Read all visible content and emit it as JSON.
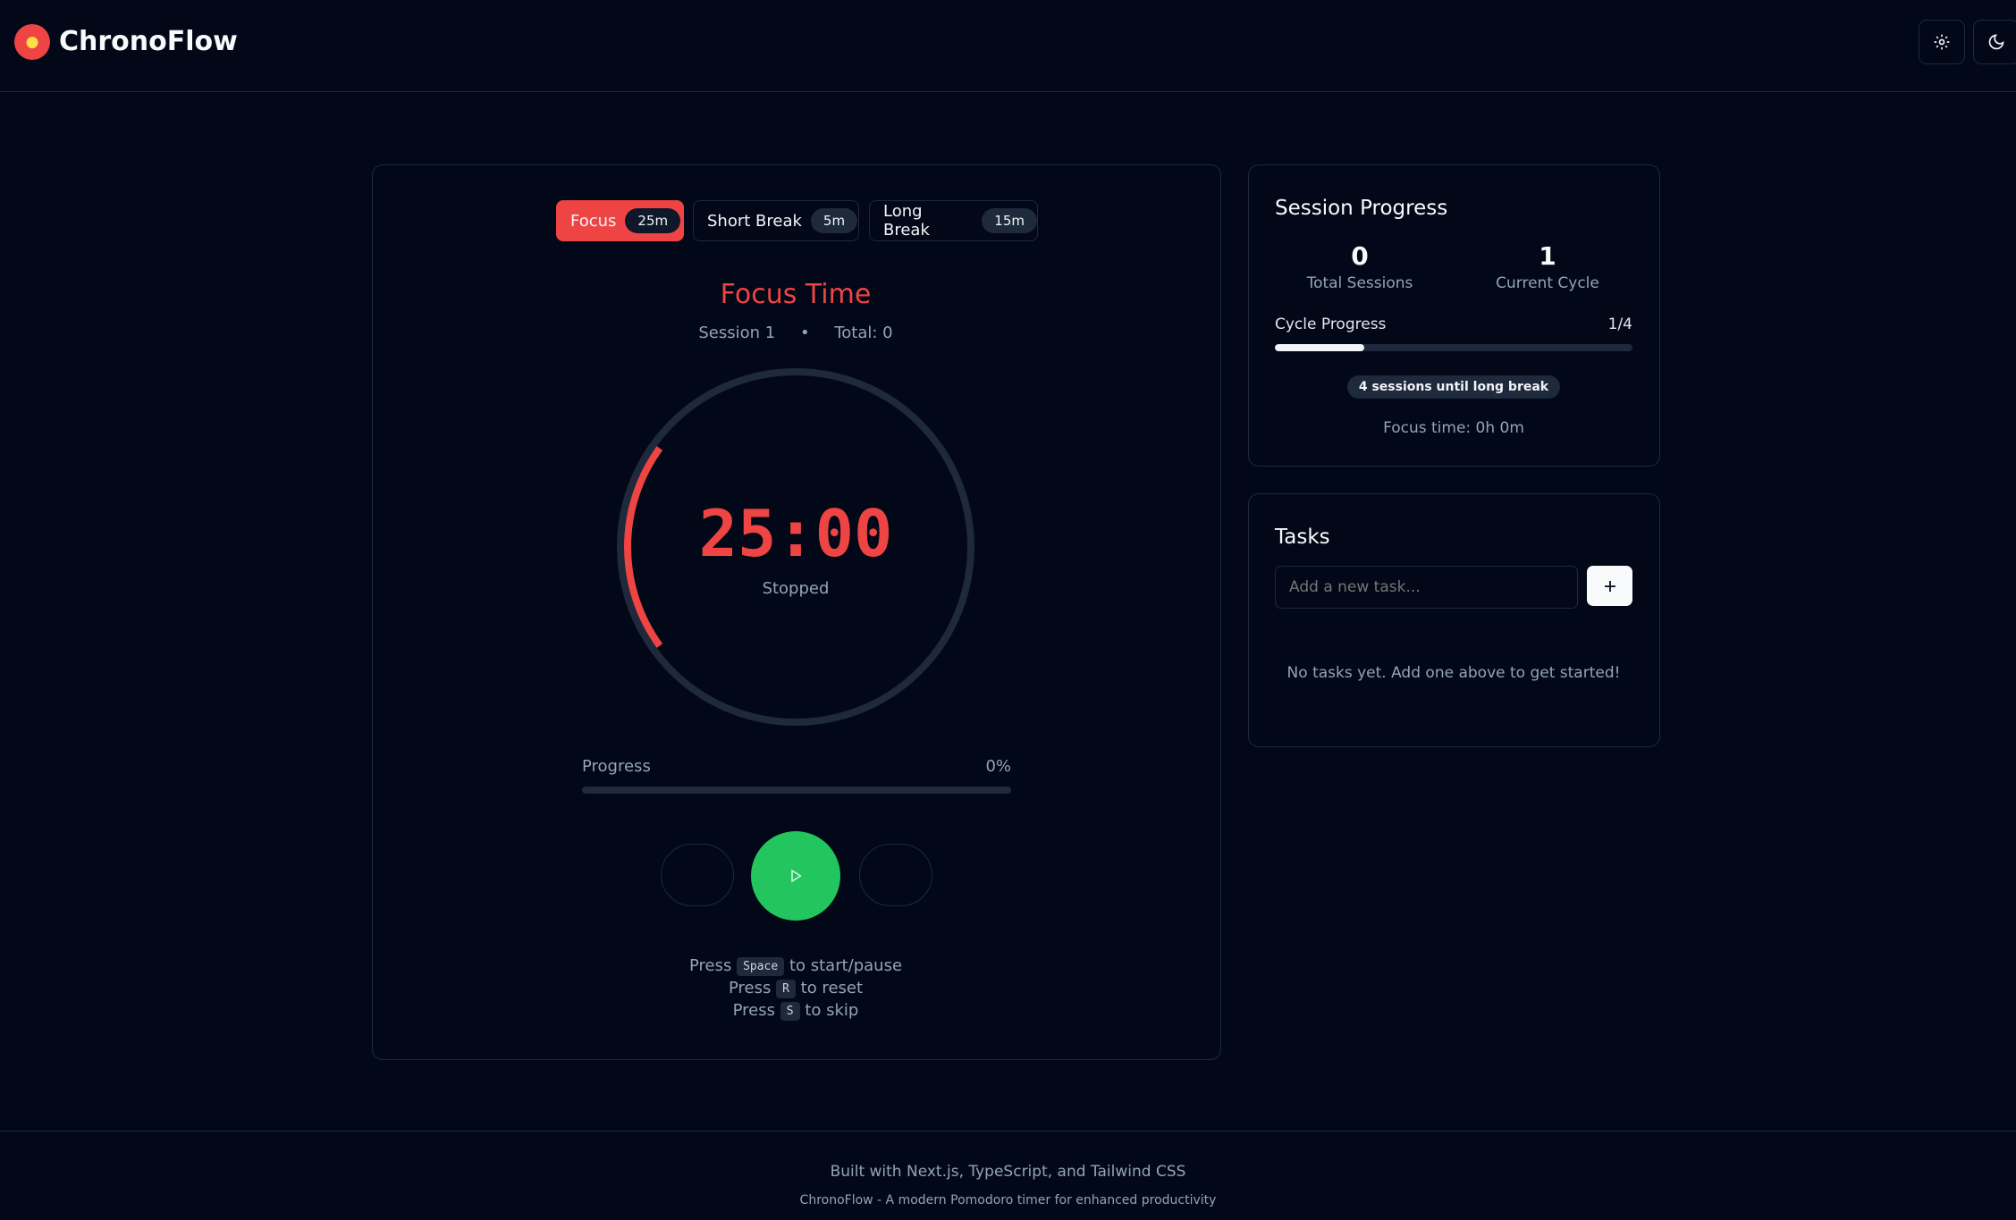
{
  "app": {
    "name": "ChronoFlow",
    "logo_icon": "tomato-icon",
    "accent": "#ef4444",
    "success": "#22c55e"
  },
  "header": {
    "settings_icon": "gear-icon",
    "theme_icon": "moon-icon"
  },
  "modes": [
    {
      "label": "Focus",
      "duration": "25m",
      "active": true
    },
    {
      "label": "Short Break",
      "duration": "5m",
      "active": false
    },
    {
      "label": "Long Break",
      "duration": "15m",
      "active": false
    }
  ],
  "timer": {
    "mode_title": "Focus Time",
    "session_label": "Session 1",
    "separator": "•",
    "total_label": "Total: 0",
    "time": "25:00",
    "status": "Stopped",
    "ring_fraction": 0.2,
    "progress_label": "Progress",
    "progress_value": "0%",
    "progress_fraction": 0
  },
  "controls": {
    "play_icon": "play-icon"
  },
  "shortcuts": [
    {
      "pre": "Press",
      "key": "Space",
      "post": "to start/pause"
    },
    {
      "pre": "Press",
      "key": "R",
      "post": "to reset"
    },
    {
      "pre": "Press",
      "key": "S",
      "post": "to skip"
    }
  ],
  "session_progress": {
    "title": "Session Progress",
    "total_sessions_value": "0",
    "total_sessions_label": "Total Sessions",
    "current_cycle_value": "1",
    "current_cycle_label": "Current Cycle",
    "cycle_progress_label": "Cycle Progress",
    "cycle_progress_value": "1/4",
    "cycle_progress_fraction": 0.25,
    "badge": "4 sessions until long break",
    "focus_time": "Focus time: 0h 0m"
  },
  "tasks": {
    "title": "Tasks",
    "input_placeholder": "Add a new task...",
    "add_icon": "plus-icon",
    "empty_message": "No tasks yet. Add one above to get started!"
  },
  "footer": {
    "line1": "Built with Next.js, TypeScript, and Tailwind CSS",
    "line2": "ChronoFlow - A modern Pomodoro timer for enhanced productivity"
  }
}
